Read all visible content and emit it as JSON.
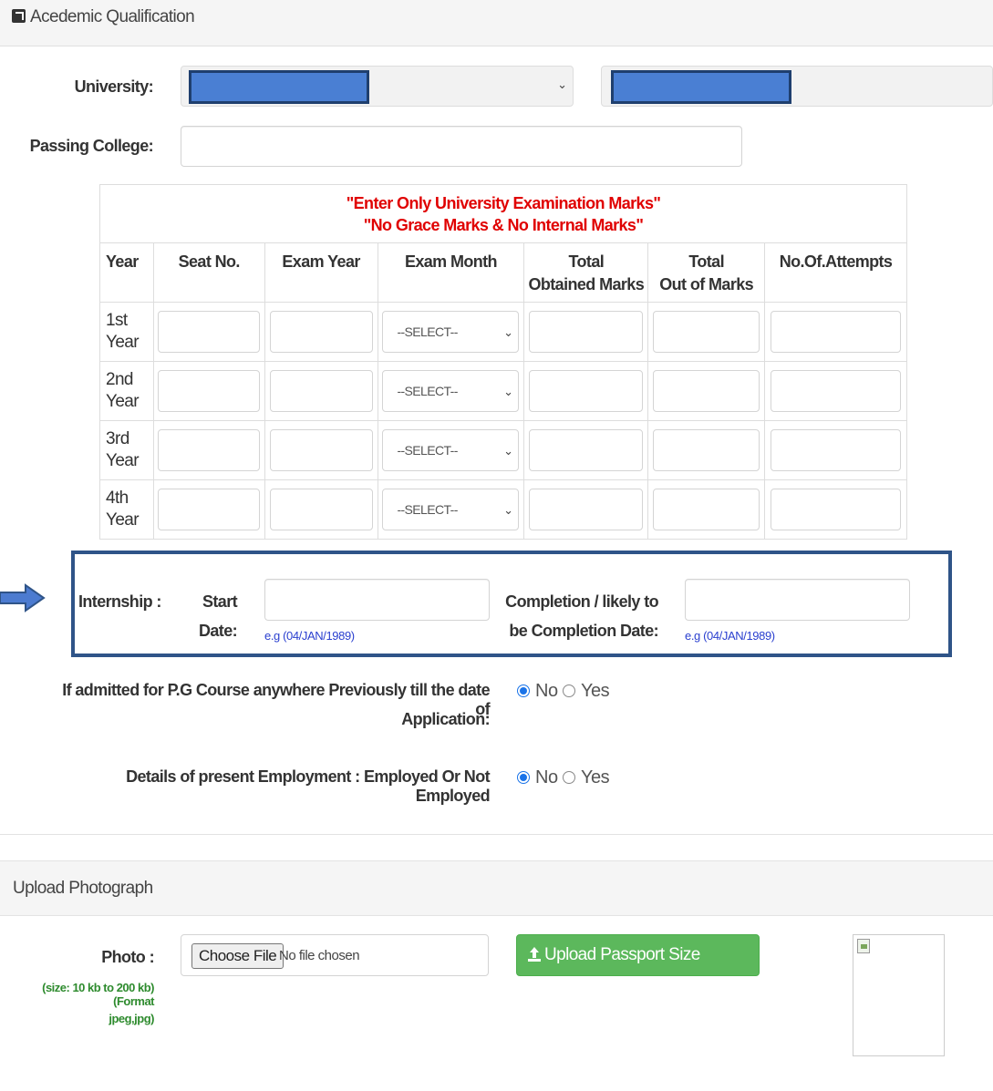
{
  "section1": {
    "title": "Acedemic Qualification",
    "icon": "external-link-icon"
  },
  "university": {
    "label": "University:",
    "select_value": "",
    "second_value": ""
  },
  "college": {
    "label": "Passing College:",
    "value": ""
  },
  "marks_table": {
    "warning_line1": "\"Enter Only University Examination Marks\"",
    "warning_line2": "\"No Grace Marks & No Internal Marks\"",
    "columns": [
      "Year",
      "Seat No.",
      "Exam Year",
      "Exam Month",
      "Total",
      "Obtained Marks",
      "Total",
      "Out of Marks",
      "No.Of.Attempts"
    ],
    "rows": [
      {
        "num": "1st",
        "word": "Year",
        "month": "--SELECT--"
      },
      {
        "num": "2nd",
        "word": "Year",
        "month": "--SELECT--"
      },
      {
        "num": "3rd",
        "word": "Year",
        "month": "--SELECT--"
      },
      {
        "num": "4th",
        "word": "Year",
        "month": "--SELECT--"
      }
    ]
  },
  "internship": {
    "label": "Internship :",
    "start_label_1": "Start",
    "start_label_2": "Date:",
    "start_hint": "e.g (04/JAN/1989)",
    "completion_label_1": "Completion / likely to",
    "completion_label_2": "be Completion Date:",
    "completion_hint": "e.g (04/JAN/1989)",
    "start_value": "",
    "completion_value": ""
  },
  "pg_course": {
    "label_line1": "If admitted for P.G Course anywhere Previously till the date of",
    "label_line2": "Application:",
    "option_no": "No",
    "option_yes": "Yes",
    "selected": "No"
  },
  "employment": {
    "label": "Details of present Employment : Employed Or Not Employed",
    "option_no": "No",
    "option_yes": "Yes",
    "selected": "No"
  },
  "section2": {
    "title": "Upload Photograph"
  },
  "photo": {
    "label": "Photo :",
    "note_line1": "(size: 10 kb to 200 kb) (Format",
    "note_line2": "jpeg,jpg)",
    "choose_button": "Choose File",
    "file_status": "No file chosen",
    "upload_button": "Upload Passport Size Photograph",
    "upload_icon": "upload-icon",
    "preview_icon": "broken-image-icon"
  },
  "colors": {
    "warning_red": "#e00000",
    "hint_blue": "#2a3fcf",
    "highlight_border": "#2f5488",
    "upload_green": "#5cb85c",
    "note_green": "#2e8b2e"
  }
}
